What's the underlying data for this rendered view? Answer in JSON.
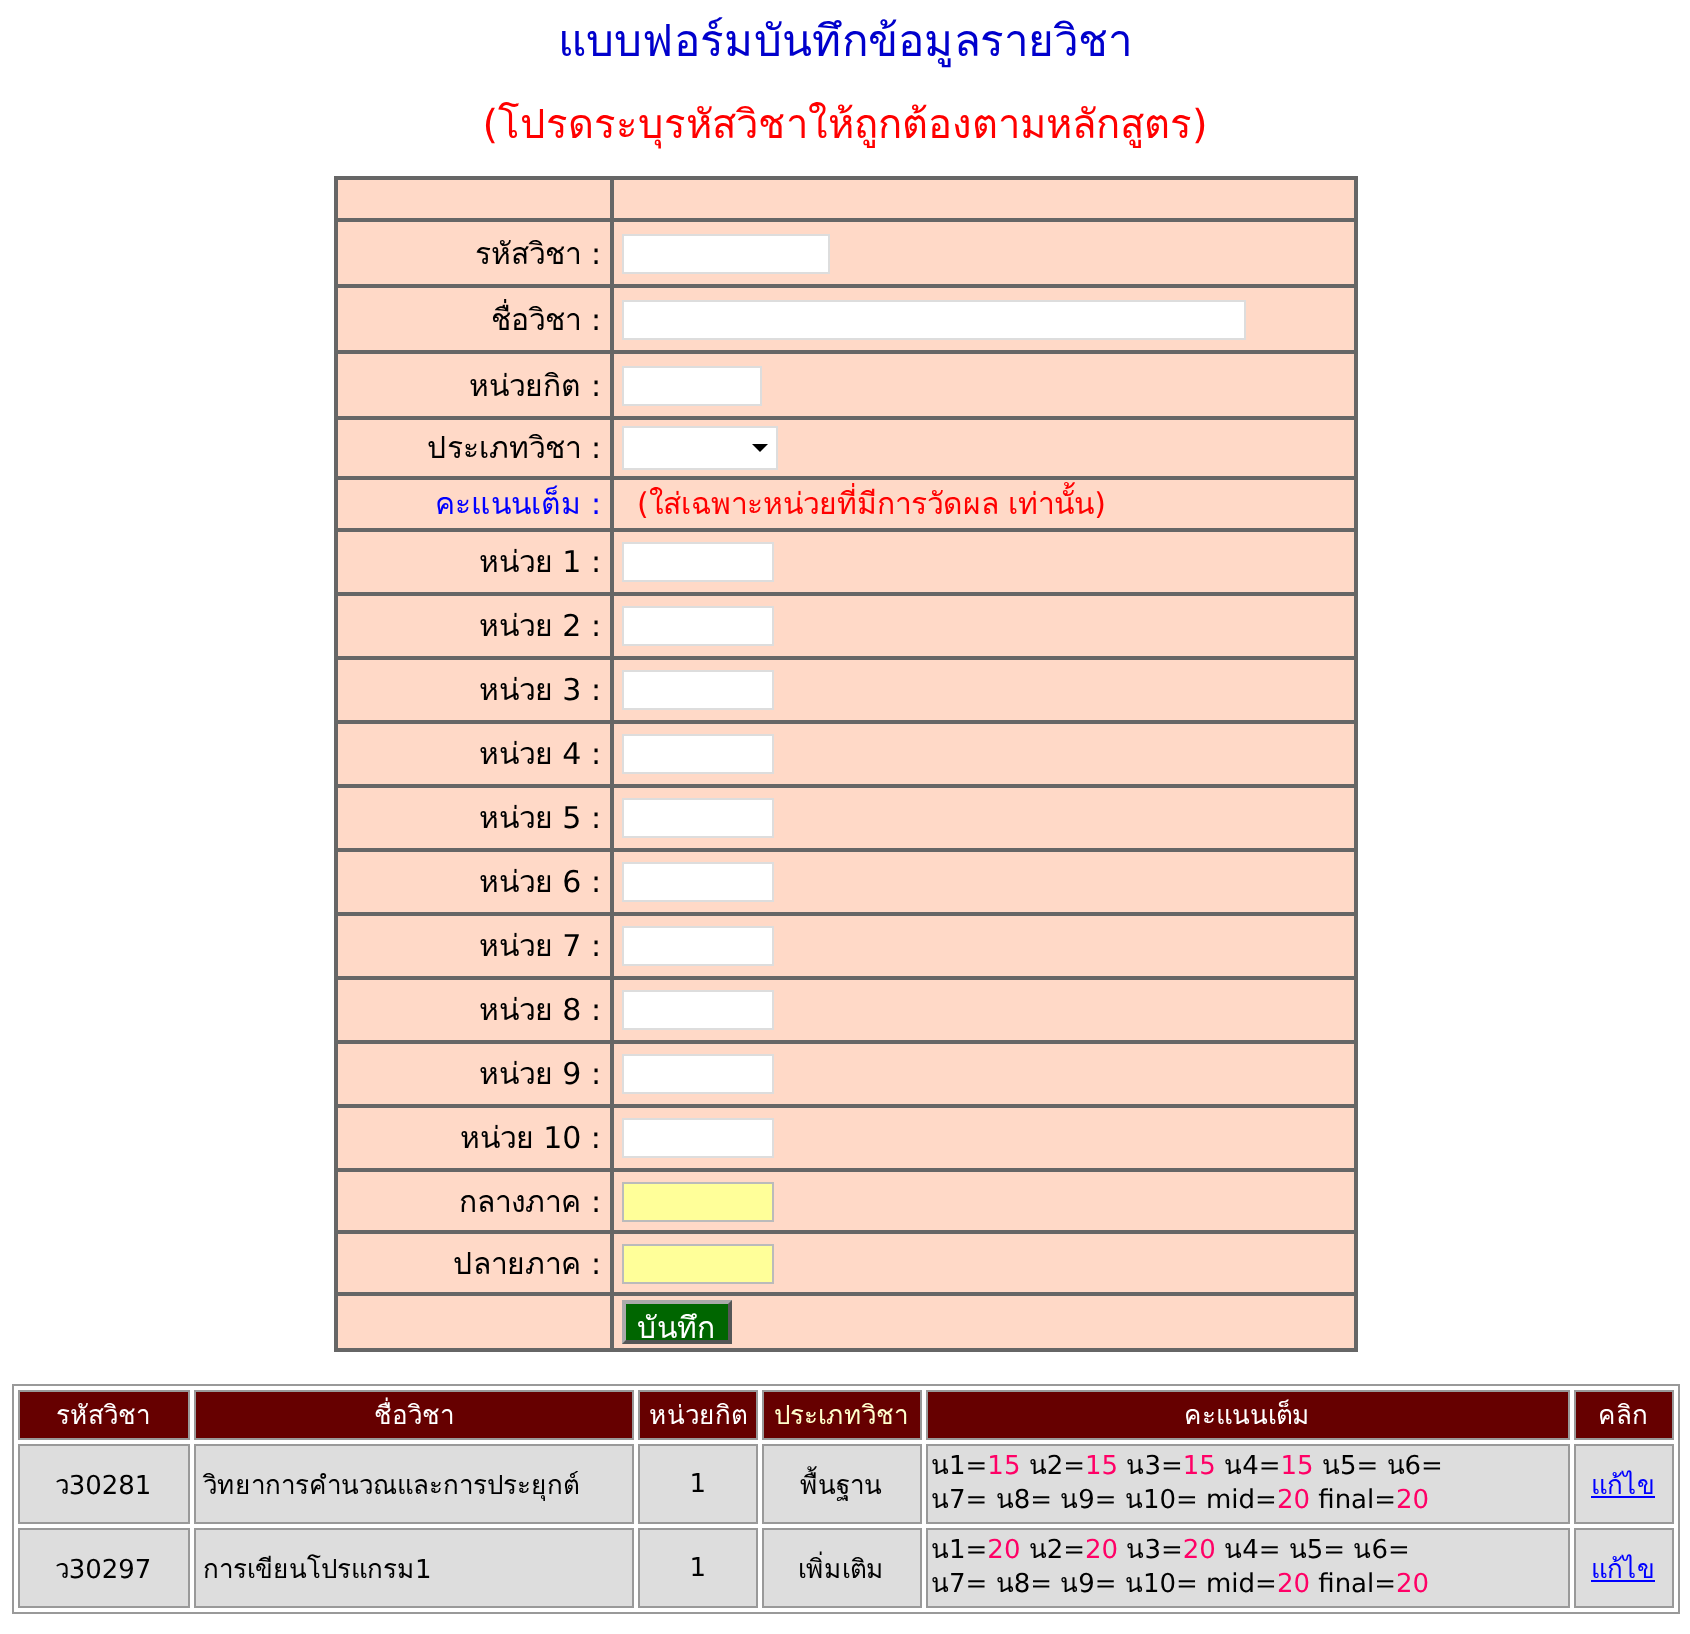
{
  "title": "แบบฟอร์มบันทึกข้อมูลรายวิชา",
  "subtitle": "(โปรดระบุรหัสวิชาให้ถูกต้องตามหลักสูตร)",
  "form": {
    "rows": [
      {
        "kind": "code",
        "label": "รหัสวิชา :"
      },
      {
        "kind": "name",
        "label": "ชื่อวิชา :"
      },
      {
        "kind": "credit",
        "label": "หน่วยกิต :"
      },
      {
        "kind": "select",
        "label": "ประเภทวิชา :"
      },
      {
        "kind": "note",
        "label": "คะแนนเต็ม :",
        "note": "(ใส่เฉพาะหน่วยที่มีการวัดผล เท่านั้น)"
      },
      {
        "kind": "unit",
        "label": "หน่วย 1 :"
      },
      {
        "kind": "unit",
        "label": "หน่วย 2 :"
      },
      {
        "kind": "unit",
        "label": "หน่วย 3 :"
      },
      {
        "kind": "unit",
        "label": "หน่วย 4 :"
      },
      {
        "kind": "unit",
        "label": "หน่วย 5 :"
      },
      {
        "kind": "unit",
        "label": "หน่วย 6 :"
      },
      {
        "kind": "unit",
        "label": "หน่วย 7 :"
      },
      {
        "kind": "unit",
        "label": "หน่วย 8 :"
      },
      {
        "kind": "unit",
        "label": "หน่วย 9 :"
      },
      {
        "kind": "unit",
        "label": "หน่วย 10 :"
      },
      {
        "kind": "exam",
        "label": "กลางภาค :"
      },
      {
        "kind": "exam",
        "label": "ปลายภาค :"
      }
    ],
    "submit": "บันทึก"
  },
  "table": {
    "columns": [
      "รหัสวิชา",
      "ชื่อวิชา",
      "หน่วยกิต",
      "ประเภทวิชา",
      "คะแนนเต็ม",
      "คลิก"
    ],
    "rows": [
      {
        "code": "ว30281",
        "name": "วิทยาการคำนวณและการประยุกต์",
        "credit": "1",
        "type": "พื้นฐาน",
        "scores": [
          {
            "label": "น1=",
            "value": "15"
          },
          {
            "label": "น2=",
            "value": "15"
          },
          {
            "label": "น3=",
            "value": "15"
          },
          {
            "label": "น4=",
            "value": "15"
          },
          {
            "label": "น5="
          },
          {
            "label": "น6="
          },
          {
            "label": "น7="
          },
          {
            "label": "น8="
          },
          {
            "label": "น9="
          },
          {
            "label": "น10="
          },
          {
            "label": "mid=",
            "value": "20"
          },
          {
            "label": "final=",
            "value": "20"
          }
        ],
        "action": "แก้ไข"
      },
      {
        "code": "ว30297",
        "name": "การเขียนโปรแกรม1",
        "credit": "1",
        "type": "เพิ่มเติม",
        "scores": [
          {
            "label": "น1=",
            "value": "20"
          },
          {
            "label": "น2=",
            "value": "20"
          },
          {
            "label": "น3=",
            "value": "20"
          },
          {
            "label": "น4="
          },
          {
            "label": "น5="
          },
          {
            "label": "น6="
          },
          {
            "label": "น7="
          },
          {
            "label": "น8="
          },
          {
            "label": "น9="
          },
          {
            "label": "น10="
          },
          {
            "label": "mid=",
            "value": "20"
          },
          {
            "label": "final=",
            "value": "20"
          }
        ],
        "action": "แก้ไข"
      }
    ]
  }
}
